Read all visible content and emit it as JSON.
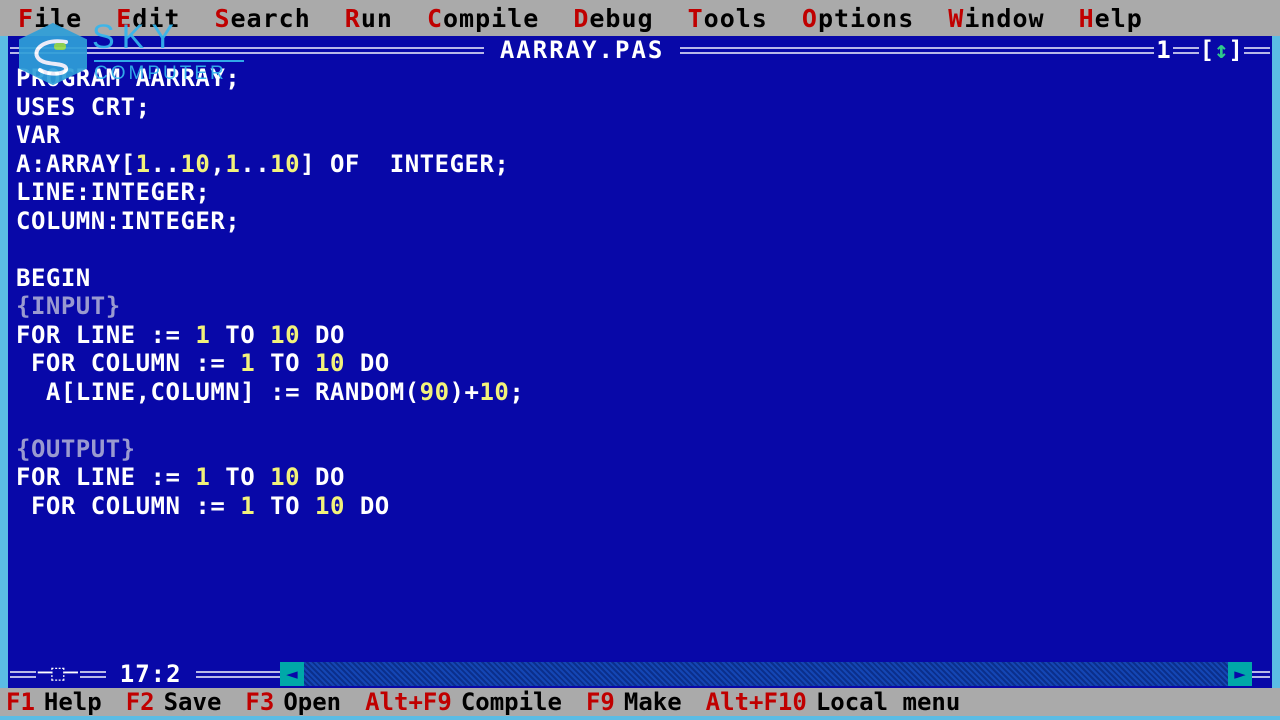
{
  "theme": {
    "bezel": "#5bbce4",
    "editor_bg": "#0808a8",
    "bar_bg": "#aaaaaa",
    "hotkey_red": "#c00000",
    "code_white": "#ffffff",
    "code_yellow": "#f2f27a",
    "comment_gray": "#9a9ad0",
    "scroll_teal": "#00a8a8",
    "logo_cyan": "#35b6ee"
  },
  "menubar": {
    "items": [
      {
        "hot": "F",
        "rest": "ile"
      },
      {
        "hot": "E",
        "rest": "dit"
      },
      {
        "hot": "S",
        "rest": "earch"
      },
      {
        "hot": "R",
        "rest": "un"
      },
      {
        "hot": "C",
        "rest": "ompile"
      },
      {
        "hot": "D",
        "rest": "ebug"
      },
      {
        "hot": "T",
        "rest": "ools"
      },
      {
        "hot": "O",
        "rest": "ptions"
      },
      {
        "hot": "W",
        "rest": "indow"
      },
      {
        "hot": "H",
        "rest": "elp"
      }
    ]
  },
  "window": {
    "title": "AARRAY.PAS",
    "number": "1",
    "maximize_left": "[",
    "maximize_arrows": "↕",
    "maximize_right": "]",
    "resize_glyph": "─⬚─",
    "cursor_position": "17:2",
    "scroll_left_arrow": "◄",
    "scroll_right_arrow": "►"
  },
  "code": {
    "lines": [
      [
        {
          "t": "PROGRAM AARRAY;",
          "c": "w"
        }
      ],
      [
        {
          "t": "USES CRT;",
          "c": "w"
        }
      ],
      [
        {
          "t": "VAR",
          "c": "w"
        }
      ],
      [
        {
          "t": "A:ARRAY[",
          "c": "w"
        },
        {
          "t": "1",
          "c": "y"
        },
        {
          "t": "..",
          "c": "w"
        },
        {
          "t": "10",
          "c": "y"
        },
        {
          "t": ",",
          "c": "w"
        },
        {
          "t": "1",
          "c": "y"
        },
        {
          "t": "..",
          "c": "w"
        },
        {
          "t": "10",
          "c": "y"
        },
        {
          "t": "] OF  INTEGER;",
          "c": "w"
        }
      ],
      [
        {
          "t": "LINE:INTEGER;",
          "c": "w"
        }
      ],
      [
        {
          "t": "COLUMN:INTEGER;",
          "c": "w"
        }
      ],
      [
        {
          "t": "",
          "c": "w"
        }
      ],
      [
        {
          "t": "BEGIN",
          "c": "w"
        }
      ],
      [
        {
          "t": "{INPUT}",
          "c": "g"
        }
      ],
      [
        {
          "t": "FOR LINE := ",
          "c": "w"
        },
        {
          "t": "1",
          "c": "y"
        },
        {
          "t": " TO ",
          "c": "w"
        },
        {
          "t": "10",
          "c": "y"
        },
        {
          "t": " DO",
          "c": "w"
        }
      ],
      [
        {
          "t": " FOR COLUMN := ",
          "c": "w"
        },
        {
          "t": "1",
          "c": "y"
        },
        {
          "t": " TO ",
          "c": "w"
        },
        {
          "t": "10",
          "c": "y"
        },
        {
          "t": " DO",
          "c": "w"
        }
      ],
      [
        {
          "t": "  A[LINE,COLUMN] := RANDOM(",
          "c": "w"
        },
        {
          "t": "90",
          "c": "y"
        },
        {
          "t": ")+",
          "c": "w"
        },
        {
          "t": "10",
          "c": "y"
        },
        {
          "t": ";",
          "c": "w"
        }
      ],
      [
        {
          "t": "",
          "c": "w"
        }
      ],
      [
        {
          "t": "{OUTPUT}",
          "c": "g"
        }
      ],
      [
        {
          "t": "FOR LINE := ",
          "c": "w"
        },
        {
          "t": "1",
          "c": "y"
        },
        {
          "t": " TO ",
          "c": "w"
        },
        {
          "t": "10",
          "c": "y"
        },
        {
          "t": " DO",
          "c": "w"
        }
      ],
      [
        {
          "t": " FOR COLUMN := ",
          "c": "w"
        },
        {
          "t": "1",
          "c": "y"
        },
        {
          "t": " TO ",
          "c": "w"
        },
        {
          "t": "10",
          "c": "y"
        },
        {
          "t": " DO",
          "c": "w"
        }
      ]
    ]
  },
  "statusbar": {
    "keys": [
      {
        "key": "F1",
        "label": "Help"
      },
      {
        "key": "F2",
        "label": "Save"
      },
      {
        "key": "F3",
        "label": "Open"
      },
      {
        "key": "Alt+F9",
        "label": "Compile"
      },
      {
        "key": "F9",
        "label": "Make"
      },
      {
        "key": "Alt+F10",
        "label": "Local menu"
      }
    ]
  },
  "watermark": {
    "sky": "SKY",
    "computer": "COMPUTER"
  }
}
